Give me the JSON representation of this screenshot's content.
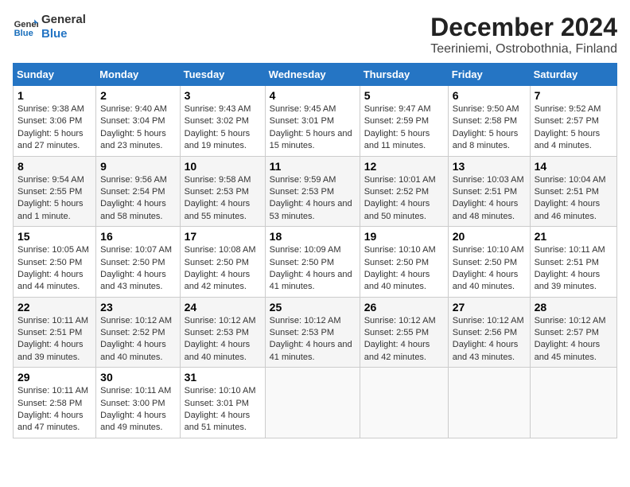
{
  "header": {
    "logo_line1": "General",
    "logo_line2": "Blue",
    "title": "December 2024",
    "subtitle": "Teeriniemi, Ostrobothnia, Finland"
  },
  "weekdays": [
    "Sunday",
    "Monday",
    "Tuesday",
    "Wednesday",
    "Thursday",
    "Friday",
    "Saturday"
  ],
  "weeks": [
    [
      {
        "day": "1",
        "sunrise": "Sunrise: 9:38 AM",
        "sunset": "Sunset: 3:06 PM",
        "daylight": "Daylight: 5 hours and 27 minutes."
      },
      {
        "day": "2",
        "sunrise": "Sunrise: 9:40 AM",
        "sunset": "Sunset: 3:04 PM",
        "daylight": "Daylight: 5 hours and 23 minutes."
      },
      {
        "day": "3",
        "sunrise": "Sunrise: 9:43 AM",
        "sunset": "Sunset: 3:02 PM",
        "daylight": "Daylight: 5 hours and 19 minutes."
      },
      {
        "day": "4",
        "sunrise": "Sunrise: 9:45 AM",
        "sunset": "Sunset: 3:01 PM",
        "daylight": "Daylight: 5 hours and 15 minutes."
      },
      {
        "day": "5",
        "sunrise": "Sunrise: 9:47 AM",
        "sunset": "Sunset: 2:59 PM",
        "daylight": "Daylight: 5 hours and 11 minutes."
      },
      {
        "day": "6",
        "sunrise": "Sunrise: 9:50 AM",
        "sunset": "Sunset: 2:58 PM",
        "daylight": "Daylight: 5 hours and 8 minutes."
      },
      {
        "day": "7",
        "sunrise": "Sunrise: 9:52 AM",
        "sunset": "Sunset: 2:57 PM",
        "daylight": "Daylight: 5 hours and 4 minutes."
      }
    ],
    [
      {
        "day": "8",
        "sunrise": "Sunrise: 9:54 AM",
        "sunset": "Sunset: 2:55 PM",
        "daylight": "Daylight: 5 hours and 1 minute."
      },
      {
        "day": "9",
        "sunrise": "Sunrise: 9:56 AM",
        "sunset": "Sunset: 2:54 PM",
        "daylight": "Daylight: 4 hours and 58 minutes."
      },
      {
        "day": "10",
        "sunrise": "Sunrise: 9:58 AM",
        "sunset": "Sunset: 2:53 PM",
        "daylight": "Daylight: 4 hours and 55 minutes."
      },
      {
        "day": "11",
        "sunrise": "Sunrise: 9:59 AM",
        "sunset": "Sunset: 2:53 PM",
        "daylight": "Daylight: 4 hours and 53 minutes."
      },
      {
        "day": "12",
        "sunrise": "Sunrise: 10:01 AM",
        "sunset": "Sunset: 2:52 PM",
        "daylight": "Daylight: 4 hours and 50 minutes."
      },
      {
        "day": "13",
        "sunrise": "Sunrise: 10:03 AM",
        "sunset": "Sunset: 2:51 PM",
        "daylight": "Daylight: 4 hours and 48 minutes."
      },
      {
        "day": "14",
        "sunrise": "Sunrise: 10:04 AM",
        "sunset": "Sunset: 2:51 PM",
        "daylight": "Daylight: 4 hours and 46 minutes."
      }
    ],
    [
      {
        "day": "15",
        "sunrise": "Sunrise: 10:05 AM",
        "sunset": "Sunset: 2:50 PM",
        "daylight": "Daylight: 4 hours and 44 minutes."
      },
      {
        "day": "16",
        "sunrise": "Sunrise: 10:07 AM",
        "sunset": "Sunset: 2:50 PM",
        "daylight": "Daylight: 4 hours and 43 minutes."
      },
      {
        "day": "17",
        "sunrise": "Sunrise: 10:08 AM",
        "sunset": "Sunset: 2:50 PM",
        "daylight": "Daylight: 4 hours and 42 minutes."
      },
      {
        "day": "18",
        "sunrise": "Sunrise: 10:09 AM",
        "sunset": "Sunset: 2:50 PM",
        "daylight": "Daylight: 4 hours and 41 minutes."
      },
      {
        "day": "19",
        "sunrise": "Sunrise: 10:10 AM",
        "sunset": "Sunset: 2:50 PM",
        "daylight": "Daylight: 4 hours and 40 minutes."
      },
      {
        "day": "20",
        "sunrise": "Sunrise: 10:10 AM",
        "sunset": "Sunset: 2:50 PM",
        "daylight": "Daylight: 4 hours and 40 minutes."
      },
      {
        "day": "21",
        "sunrise": "Sunrise: 10:11 AM",
        "sunset": "Sunset: 2:51 PM",
        "daylight": "Daylight: 4 hours and 39 minutes."
      }
    ],
    [
      {
        "day": "22",
        "sunrise": "Sunrise: 10:11 AM",
        "sunset": "Sunset: 2:51 PM",
        "daylight": "Daylight: 4 hours and 39 minutes."
      },
      {
        "day": "23",
        "sunrise": "Sunrise: 10:12 AM",
        "sunset": "Sunset: 2:52 PM",
        "daylight": "Daylight: 4 hours and 40 minutes."
      },
      {
        "day": "24",
        "sunrise": "Sunrise: 10:12 AM",
        "sunset": "Sunset: 2:53 PM",
        "daylight": "Daylight: 4 hours and 40 minutes."
      },
      {
        "day": "25",
        "sunrise": "Sunrise: 10:12 AM",
        "sunset": "Sunset: 2:53 PM",
        "daylight": "Daylight: 4 hours and 41 minutes."
      },
      {
        "day": "26",
        "sunrise": "Sunrise: 10:12 AM",
        "sunset": "Sunset: 2:55 PM",
        "daylight": "Daylight: 4 hours and 42 minutes."
      },
      {
        "day": "27",
        "sunrise": "Sunrise: 10:12 AM",
        "sunset": "Sunset: 2:56 PM",
        "daylight": "Daylight: 4 hours and 43 minutes."
      },
      {
        "day": "28",
        "sunrise": "Sunrise: 10:12 AM",
        "sunset": "Sunset: 2:57 PM",
        "daylight": "Daylight: 4 hours and 45 minutes."
      }
    ],
    [
      {
        "day": "29",
        "sunrise": "Sunrise: 10:11 AM",
        "sunset": "Sunset: 2:58 PM",
        "daylight": "Daylight: 4 hours and 47 minutes."
      },
      {
        "day": "30",
        "sunrise": "Sunrise: 10:11 AM",
        "sunset": "Sunset: 3:00 PM",
        "daylight": "Daylight: 4 hours and 49 minutes."
      },
      {
        "day": "31",
        "sunrise": "Sunrise: 10:10 AM",
        "sunset": "Sunset: 3:01 PM",
        "daylight": "Daylight: 4 hours and 51 minutes."
      },
      null,
      null,
      null,
      null
    ]
  ]
}
